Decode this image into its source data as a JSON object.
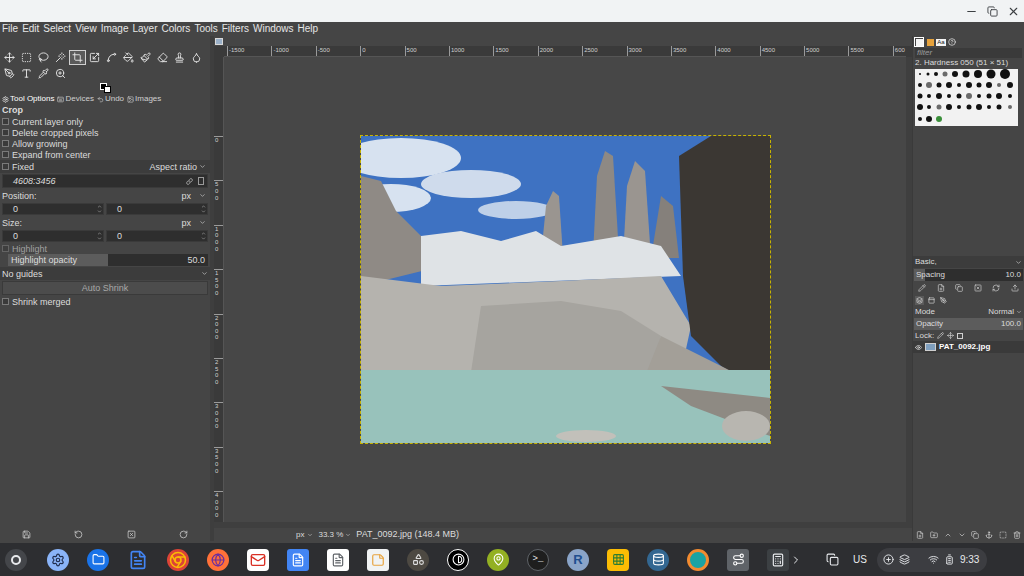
{
  "menu": [
    "File",
    "Edit",
    "Select",
    "View",
    "Image",
    "Layer",
    "Colors",
    "Tools",
    "Filters",
    "Windows",
    "Help"
  ],
  "toolbox": {
    "tools": [
      {
        "selected": false
      },
      {
        "selected": false
      },
      {
        "selected": false
      },
      {
        "selected": false
      },
      {
        "selected": true
      },
      {
        "selected": false
      },
      {
        "selected": false
      },
      {
        "selected": false
      },
      {
        "selected": false
      },
      {
        "selected": false
      },
      {
        "selected": false
      },
      {
        "selected": false
      },
      {
        "selected": false
      },
      {
        "selected": false
      },
      {
        "selected": false
      },
      {
        "selected": false
      }
    ]
  },
  "tool_options": {
    "tabs": [
      {
        "label": "Tool Options",
        "selected": true
      },
      {
        "label": "Devices",
        "selected": false
      },
      {
        "label": "Undo",
        "selected": false
      },
      {
        "label": "Images",
        "selected": false
      }
    ],
    "title": "Crop",
    "options": [
      {
        "kind": "checkbox",
        "label": "Current layer only",
        "checked": false,
        "disabled": false
      },
      {
        "kind": "checkbox",
        "label": "Delete cropped pixels",
        "checked": false,
        "disabled": false
      },
      {
        "kind": "checkbox",
        "label": "Allow growing",
        "checked": false,
        "disabled": false
      },
      {
        "kind": "checkbox",
        "label": "Expand from center",
        "checked": false,
        "disabled": false
      },
      {
        "kind": "fixed",
        "label": "Fixed",
        "checked": false,
        "value": "Aspect ratio"
      },
      {
        "kind": "field",
        "value": "4608:3456"
      },
      {
        "kind": "unit",
        "label": "Position:",
        "value": "px"
      },
      {
        "kind": "pair",
        "values": [
          "0",
          "0"
        ]
      },
      {
        "kind": "unit",
        "label": "Size:",
        "value": "px"
      },
      {
        "kind": "pair",
        "values": [
          "0",
          "0"
        ]
      },
      {
        "kind": "checkbox",
        "label": "Highlight",
        "checked": false,
        "disabled": true
      },
      {
        "kind": "slider",
        "label": "Highlight opacity",
        "value": "50.0",
        "level": 0.5
      },
      {
        "kind": "dropdown",
        "value": "No guides"
      },
      {
        "kind": "button",
        "label": "Auto Shrink",
        "disabled": true
      },
      {
        "kind": "checkbox",
        "label": "Shrink merged",
        "checked": false,
        "disabled": false
      }
    ]
  },
  "canvas": {
    "ruler_h": [
      "-1500",
      "-1000",
      "-500",
      "0",
      "500",
      "1000",
      "1500",
      "2000",
      "2500",
      "3000",
      "3500",
      "4000",
      "4500",
      "5000",
      "5500",
      "600"
    ],
    "ruler_v": [
      "0",
      "500",
      "1000",
      "1500",
      "2000",
      "2500",
      "3000",
      "3500",
      "4000"
    ]
  },
  "status_bar": {
    "unit": "px",
    "zoom": "33.3 %",
    "title": "PAT_0092.jpg (148.4 MB)"
  },
  "dock_tabs": [
    {
      "kind": "brushes",
      "selected": true
    },
    {
      "kind": "patterns",
      "selected": false
    },
    {
      "kind": "fonts",
      "label": "Aa",
      "selected": false
    },
    {
      "kind": "help",
      "selected": false
    }
  ],
  "brushes": {
    "filter_placeholder": "filter",
    "name": "2. Hardness 050 (51 × 51)",
    "tag": "Basic,",
    "spacing": {
      "label": "Spacing",
      "value": "10.0",
      "level": 0.1
    }
  },
  "layers": {
    "tabs": [
      {
        "selected": true
      },
      {
        "selected": false
      },
      {
        "selected": false
      }
    ],
    "mode_label": "Mode",
    "mode": "Normal",
    "opacity_label": "Opacity",
    "opacity": "100.0",
    "opacity_level": 1,
    "lock_label": "Lock:",
    "items": [
      {
        "name": "PAT_0092.jpg",
        "visible": true,
        "selected": true
      }
    ]
  },
  "shelf": {
    "apps": [
      {
        "kind": "settings"
      },
      {
        "kind": "files"
      },
      {
        "kind": "docs"
      },
      {
        "kind": "chrome"
      },
      {
        "kind": "firefox"
      },
      {
        "kind": "gmail"
      },
      {
        "kind": "gdocs"
      },
      {
        "kind": "textfile"
      },
      {
        "kind": "notes"
      },
      {
        "kind": "gimp"
      },
      {
        "kind": "inkscape"
      },
      {
        "kind": "qgis"
      },
      {
        "kind": "terminal",
        "glyph": ">_"
      },
      {
        "kind": "r",
        "glyph": "R"
      },
      {
        "kind": "keep"
      },
      {
        "kind": "pgadmin"
      },
      {
        "kind": "circle"
      },
      {
        "kind": "viewer"
      },
      {
        "kind": "calculator"
      }
    ],
    "ime": "US",
    "time": "9:33"
  }
}
